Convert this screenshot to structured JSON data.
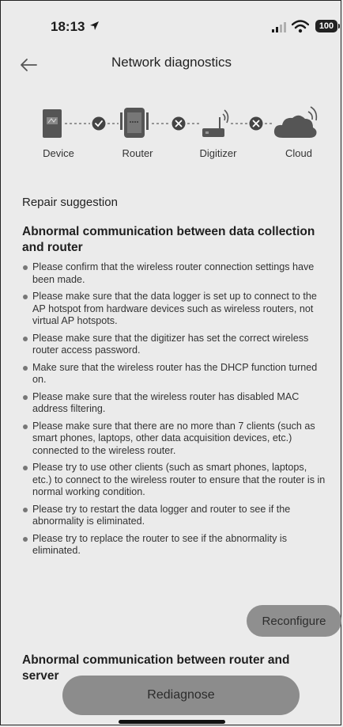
{
  "status_bar": {
    "time": "18:13",
    "battery": "100",
    "icons": [
      "location-arrow-icon",
      "signal-icon",
      "wifi-icon",
      "battery-icon"
    ]
  },
  "header": {
    "title": "Network diagnostics",
    "back_icon": "back-arrow-icon"
  },
  "diagram": {
    "nodes": [
      {
        "label": "Device",
        "icon": "device-icon"
      },
      {
        "label": "Router",
        "icon": "router-icon"
      },
      {
        "label": "Digitizer",
        "icon": "digitizer-icon"
      },
      {
        "label": "Cloud",
        "icon": "cloud-icon"
      }
    ],
    "links": [
      {
        "status": "ok",
        "icon": "check-icon"
      },
      {
        "status": "error",
        "icon": "x-icon"
      },
      {
        "status": "error",
        "icon": "x-icon"
      }
    ]
  },
  "repair": {
    "section_label": "Repair suggestion",
    "issue_1_title": "Abnormal communication between data collection and router",
    "suggestions": [
      "Please confirm that the wireless router connection settings have been made.",
      "Please make sure that the data logger is set up to connect to the AP hotspot from hardware devices such as wireless routers, not virtual AP hotspots.",
      "Please make sure that the digitizer has set the correct wireless router access password.",
      "Make sure that the wireless router has the DHCP function turned on.",
      "Please make sure that the wireless router has disabled MAC address filtering.",
      "Please make sure that there are no more than 7 clients (such as smart phones, laptops, other data acquisition devices, etc.) connected to the wireless router.",
      "Please try to use other clients (such as smart phones, laptops, etc.) to connect to the wireless router to ensure that the router is in normal working condition.",
      "Please try to restart the data logger and router to see if the abnormality is eliminated.",
      "Please try to replace the router to see if the abnormality is eliminated."
    ],
    "reconfigure_label": "Reconfigure",
    "issue_2_title": "Abnormal communication between router and server"
  },
  "footer": {
    "rediagnose_label": "Rediagnose"
  }
}
